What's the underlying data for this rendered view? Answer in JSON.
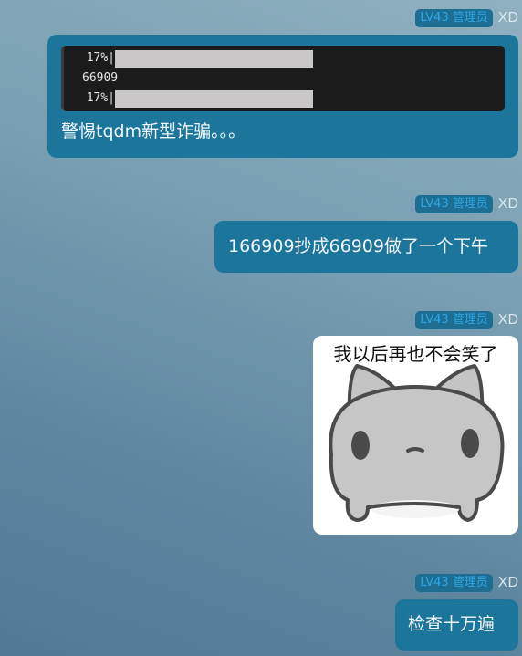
{
  "messages": [
    {
      "badge": "LV43 管理员",
      "nick": "XD",
      "code_lines": [
        "17%|",
        "66909",
        "17%|"
      ],
      "text": "警惕tqdm新型诈骗。。。"
    },
    {
      "badge": "LV43 管理员",
      "nick": "XD",
      "text": "166909抄成66909做了一个下午"
    },
    {
      "badge": "LV43 管理员",
      "nick": "XD",
      "sticker_caption": "我以后再也不会笑了",
      "sticker_icon": "gray-cat-face-sticker"
    },
    {
      "badge": "LV43 管理员",
      "nick": "XD",
      "text": "检查十万遍"
    }
  ]
}
